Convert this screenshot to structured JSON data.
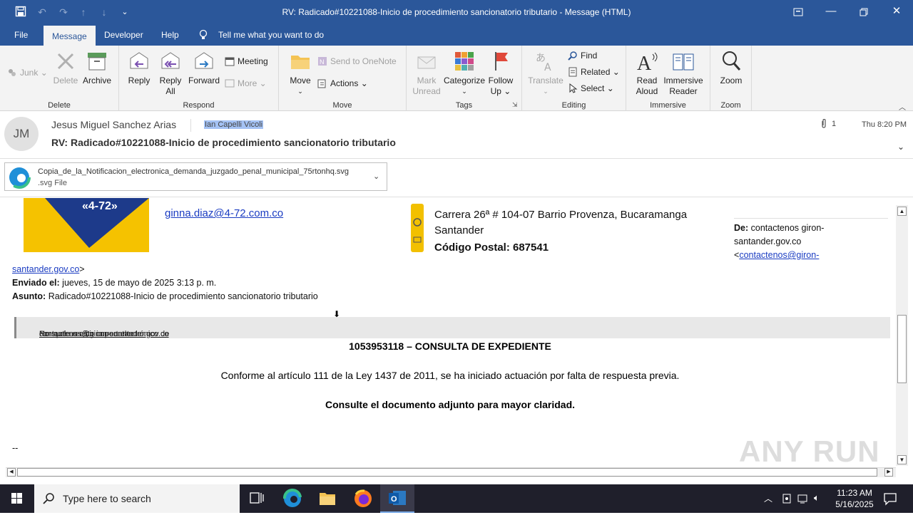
{
  "window": {
    "title": "RV: Radicado#10221088-Inicio de procedimiento sancionatorio tributario  -  Message (HTML)"
  },
  "tabs": [
    "File",
    "Message",
    "Developer",
    "Help"
  ],
  "tell_me": "Tell me what you want to do",
  "ribbon": {
    "delete_group": {
      "label": "Delete",
      "junk": "Junk",
      "delete": "Delete",
      "archive": "Archive"
    },
    "respond_group": {
      "label": "Respond",
      "reply": "Reply",
      "reply_all_1": "Reply",
      "reply_all_2": "All",
      "forward": "Forward",
      "meeting": "Meeting",
      "more": "More"
    },
    "move_group": {
      "label": "Move",
      "move": "Move",
      "onenote": "Send to OneNote",
      "actions": "Actions"
    },
    "tags_group": {
      "label": "Tags",
      "mark_unread_1": "Mark",
      "mark_unread_2": "Unread",
      "categorize": "Categorize",
      "follow_up_1": "Follow",
      "follow_up_2": "Up"
    },
    "editing_group": {
      "label": "Editing",
      "translate": "Translate",
      "find": "Find",
      "related": "Related",
      "select": "Select"
    },
    "immersive_group": {
      "label": "Immersive",
      "read_aloud_1": "Read",
      "read_aloud_2": "Aloud",
      "immersive_reader_1": "Immersive",
      "immersive_reader_2": "Reader"
    },
    "zoom_group": {
      "label": "Zoom",
      "zoom": "Zoom"
    }
  },
  "message": {
    "avatar_initials": "JM",
    "sender": "Jesus Miguel Sanchez Arias",
    "recipient": "Ian Capelli Vicoli",
    "subject": "RV: Radicado#10221088-Inicio de procedimiento sancionatorio tributario",
    "attachment_count": "1",
    "date": "Thu 8:20 PM",
    "attachment": {
      "name": "Copia_de_la_Notificacion_electronica_demanda_juzgado_penal_municipal_75rtonhq.svg",
      "type": ".svg File"
    }
  },
  "body": {
    "logo_text": "«4-72»",
    "email_link": "ginna.diaz@4-72.com.co",
    "address_line1": "Carrera 26ª # 104-07 Barrio Provenza, Bucaramanga",
    "address_line2": "Santander",
    "postal": "Código Postal: 687541",
    "de_label": "De:",
    "de_value1": " contactenos giron-",
    "de_value2": "santander.gov.co",
    "de_value3_prefix": "<",
    "de_value3_link": "contactenos@giron-",
    "cont_link": "santander.gov.co",
    "cont_suffix": ">",
    "enviado_label": "Enviado el:",
    "enviado_value": " jueves, 15 de mayo de 2025 3:13 p. m.",
    "asunto_label": "Asunto:",
    "asunto_value": " Radicado#10221088-Inicio  de procedimiento sancionatorio tributario",
    "banner_prefix": "No suele recibir correo electrónico de ",
    "banner_link": "contactenos@giron-santander.gov.co",
    "banner_sep": ". ",
    "banner_link2": "Por qué es esto importante",
    "heading": "1053953118 – CONSULTA DE EXPEDIENTE",
    "line1": "Conforme al artículo 111 de la Ley 1437 de 2011, se ha iniciado actuación por falta de respuesta previa.",
    "line2": "Consulte el documento adjunto para mayor claridad.",
    "signature_sep": "--"
  },
  "taskbar": {
    "search_placeholder": "Type here to search",
    "time": "11:23 AM",
    "date": "5/16/2025"
  },
  "watermark": "ANY RUN"
}
